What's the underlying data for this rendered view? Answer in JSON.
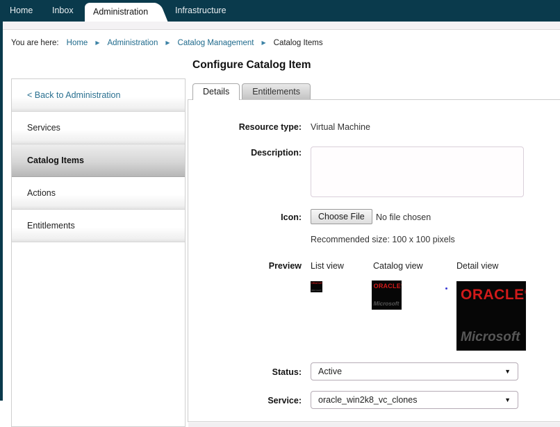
{
  "nav": {
    "items": [
      {
        "label": "Home",
        "active": false
      },
      {
        "label": "Inbox",
        "active": false
      },
      {
        "label": "Administration",
        "active": true
      },
      {
        "label": "Infrastructure",
        "active": false
      }
    ]
  },
  "breadcrumb": {
    "prefix": "You are here:",
    "links": [
      {
        "label": "Home"
      },
      {
        "label": "Administration"
      },
      {
        "label": "Catalog Management"
      }
    ],
    "current": "Catalog Items"
  },
  "page": {
    "title": "Configure Catalog Item"
  },
  "sidebar": {
    "back_link": "< Back to Administration",
    "items": [
      {
        "label": "Services",
        "selected": false
      },
      {
        "label": "Catalog Items",
        "selected": true
      },
      {
        "label": "Actions",
        "selected": false
      },
      {
        "label": "Entitlements",
        "selected": false
      }
    ]
  },
  "tabs": [
    {
      "label": "Details",
      "active": true
    },
    {
      "label": "Entitlements",
      "active": false
    }
  ],
  "form": {
    "resource_type": {
      "label": "Resource type:",
      "value": "Virtual Machine"
    },
    "description": {
      "label": "Description:",
      "value": ""
    },
    "icon": {
      "label": "Icon:",
      "button_label": "Choose File",
      "status_text": "No file chosen",
      "hint": "Recommended size: 100 x 100 pixels"
    },
    "preview": {
      "label": "Preview",
      "views": [
        {
          "label": "List view"
        },
        {
          "label": "Catalog view"
        },
        {
          "label": "Detail view"
        }
      ]
    },
    "status": {
      "label": "Status:",
      "value": "Active"
    },
    "service": {
      "label": "Service:",
      "value": "oracle_win2k8_vc_clones"
    }
  },
  "logo": {
    "line1": "ORACLE",
    "reg": "®",
    "line2": "Microsoft"
  },
  "icons": {
    "breadcrumb_arrow": "▶",
    "dropdown_arrow": "▼"
  },
  "colors": {
    "nav_bg": "#0a3a4c",
    "link": "#1f6a8c",
    "logo_red": "#d01a1a",
    "logo_gray": "#575757",
    "band_bg": "#f4f2f4",
    "selected_row": "#c4c4c4"
  }
}
